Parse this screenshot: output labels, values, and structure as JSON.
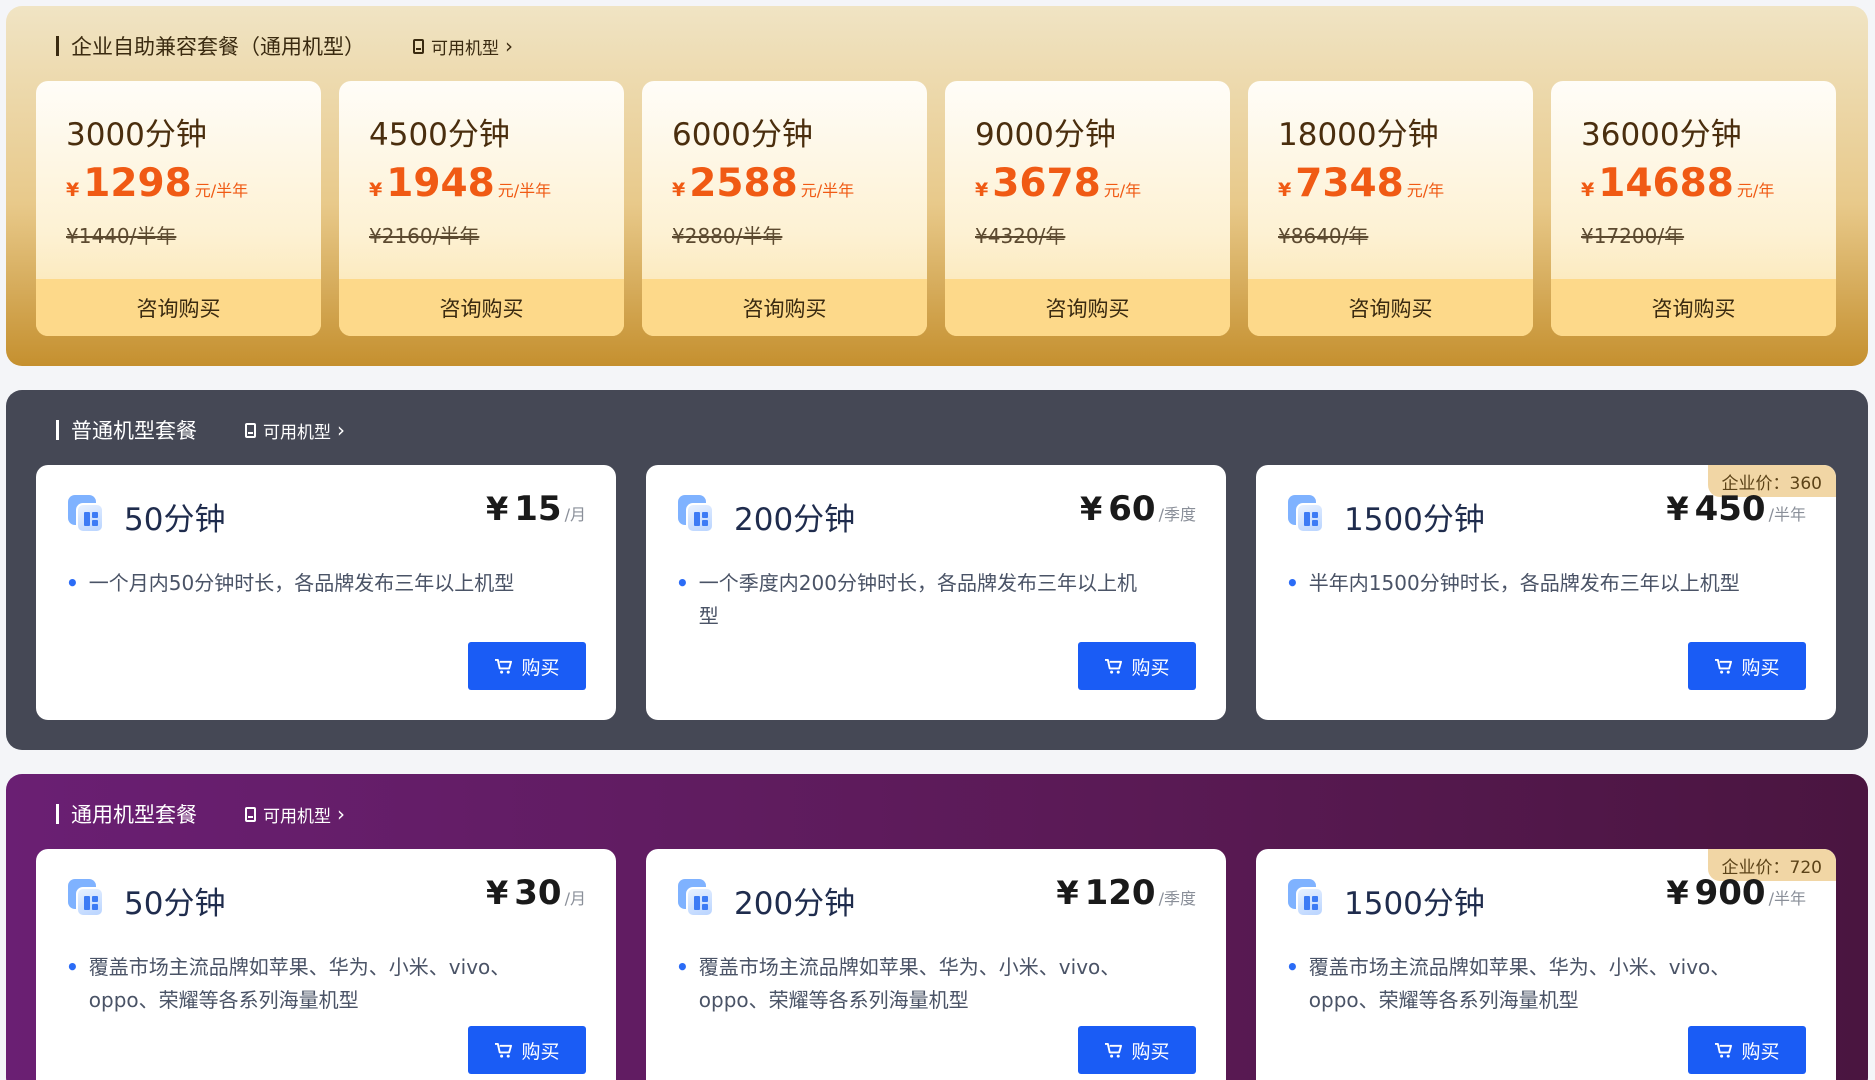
{
  "enterprise": {
    "title": "企业自助兼容套餐（通用机型）",
    "models_link": "可用机型",
    "cards": [
      {
        "minutes": "3000分钟",
        "yen": "¥",
        "price": "1298",
        "unit": "元/半年",
        "original": "¥1440/半年",
        "button": "咨询购买"
      },
      {
        "minutes": "4500分钟",
        "yen": "¥",
        "price": "1948",
        "unit": "元/半年",
        "original": "¥2160/半年",
        "button": "咨询购买"
      },
      {
        "minutes": "6000分钟",
        "yen": "¥",
        "price": "2588",
        "unit": "元/半年",
        "original": "¥2880/半年",
        "button": "咨询购买"
      },
      {
        "minutes": "9000分钟",
        "yen": "¥",
        "price": "3678",
        "unit": "元/年",
        "original": "¥4320/年",
        "button": "咨询购买"
      },
      {
        "minutes": "18000分钟",
        "yen": "¥",
        "price": "7348",
        "unit": "元/年",
        "original": "¥8640/年",
        "button": "咨询购买"
      },
      {
        "minutes": "36000分钟",
        "yen": "¥",
        "price": "14688",
        "unit": "元/年",
        "original": "¥17200/年",
        "button": "咨询购买"
      }
    ]
  },
  "normal": {
    "title": "普通机型套餐",
    "models_link": "可用机型",
    "cards": [
      {
        "minutes": "50分钟",
        "yen": "¥",
        "price": "15",
        "unit": "/月",
        "desc": "一个月内50分钟时长，各品牌发布三年以上机型",
        "button": "购买"
      },
      {
        "minutes": "200分钟",
        "yen": "¥",
        "price": "60",
        "unit": "/季度",
        "desc": "一个季度内200分钟时长，各品牌发布三年以上机型",
        "button": "购买"
      },
      {
        "minutes": "1500分钟",
        "yen": "¥",
        "price": "450",
        "unit": "/半年",
        "desc": "半年内1500分钟时长，各品牌发布三年以上机型",
        "button": "购买",
        "badge": "企业价：360"
      }
    ]
  },
  "general": {
    "title": "通用机型套餐",
    "models_link": "可用机型",
    "cards": [
      {
        "minutes": "50分钟",
        "yen": "¥",
        "price": "30",
        "unit": "/月",
        "desc": "覆盖市场主流品牌如苹果、华为、小米、vivo、oppo、荣耀等各系列海量机型",
        "button": "购买"
      },
      {
        "minutes": "200分钟",
        "yen": "¥",
        "price": "120",
        "unit": "/季度",
        "desc": "覆盖市场主流品牌如苹果、华为、小米、vivo、oppo、荣耀等各系列海量机型",
        "button": "购买"
      },
      {
        "minutes": "1500分钟",
        "yen": "¥",
        "price": "900",
        "unit": "/半年",
        "desc": "覆盖市场主流品牌如苹果、华为、小米、vivo、oppo、荣耀等各系列海量机型",
        "button": "购买",
        "badge": "企业价：720"
      }
    ]
  },
  "colors": {
    "accent_blue": "#1a5cf5",
    "price_orange": "#f05a14",
    "normal_bg": "#454855",
    "general_bg": "#6a1f73",
    "enterprise_bg": "#e8c98a"
  },
  "icons": {
    "models_link": "device-icon",
    "chevron": "chevron-right-icon",
    "package": "package-icon",
    "buy": "cart-icon"
  }
}
